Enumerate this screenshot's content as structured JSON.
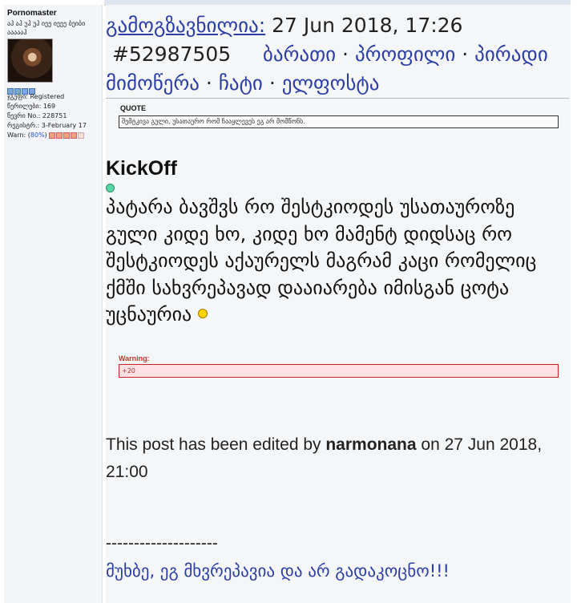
{
  "sidebar": {
    "username": "Pornomaster",
    "user_title": "აჰ აჰ უჰ უჰ იეე იეეე ბეიბი აააააჰ",
    "group_label": "ჯგუფი",
    "group": "Registered",
    "posts_label": "წერილები",
    "posts": "169",
    "member_label": "წევრი No.",
    "member_no": "228751",
    "reg_label": "რეგისტრ.",
    "registered": "3-February 17",
    "warn_label": "Warn",
    "warn_pct": "80%"
  },
  "post": {
    "sent_label": "გამოგზავნილია:",
    "date": "27 Jun 2018, 17:26",
    "number": "#52987505",
    "links": [
      "ბარათი",
      "პროფილი",
      "პირადი მიმოწერა",
      "ჩატი",
      "ელფოსტა"
    ],
    "separator": "·",
    "quote_label": "QUOTE",
    "quote_text": "შემტკივა გული, უსათაურო რომ ჩააყლევეს ეგ არ მომწონს.",
    "author_name": "KickOff",
    "body": "პატარა ბავშვს რო შესტკიოდეს უსათაუროზე გული კიდე ხო, კიდე ხო მამენტ დიდსაც რო შესტკიოდეს აქაურელს მაგრამ კაცი რომელიც ქმში სახვრეპავად დააიარება იმისგან ცოტა უცნაურია",
    "warning_label": "Warning:",
    "warning_value": "+20",
    "edited_prefix": "This post has been edited by",
    "edited_by": "narmonana",
    "edited_suffix": "on 27 Jun 2018, 21:00",
    "sig_dashes": "--------------------",
    "signature": "მუხბე, ეგ მხვრეპავია და არ გადაკოცნო!!!"
  },
  "colors": {
    "link": "#2c3ea6",
    "warning_red": "#c0392b",
    "online_dot": "#58d6a6"
  }
}
